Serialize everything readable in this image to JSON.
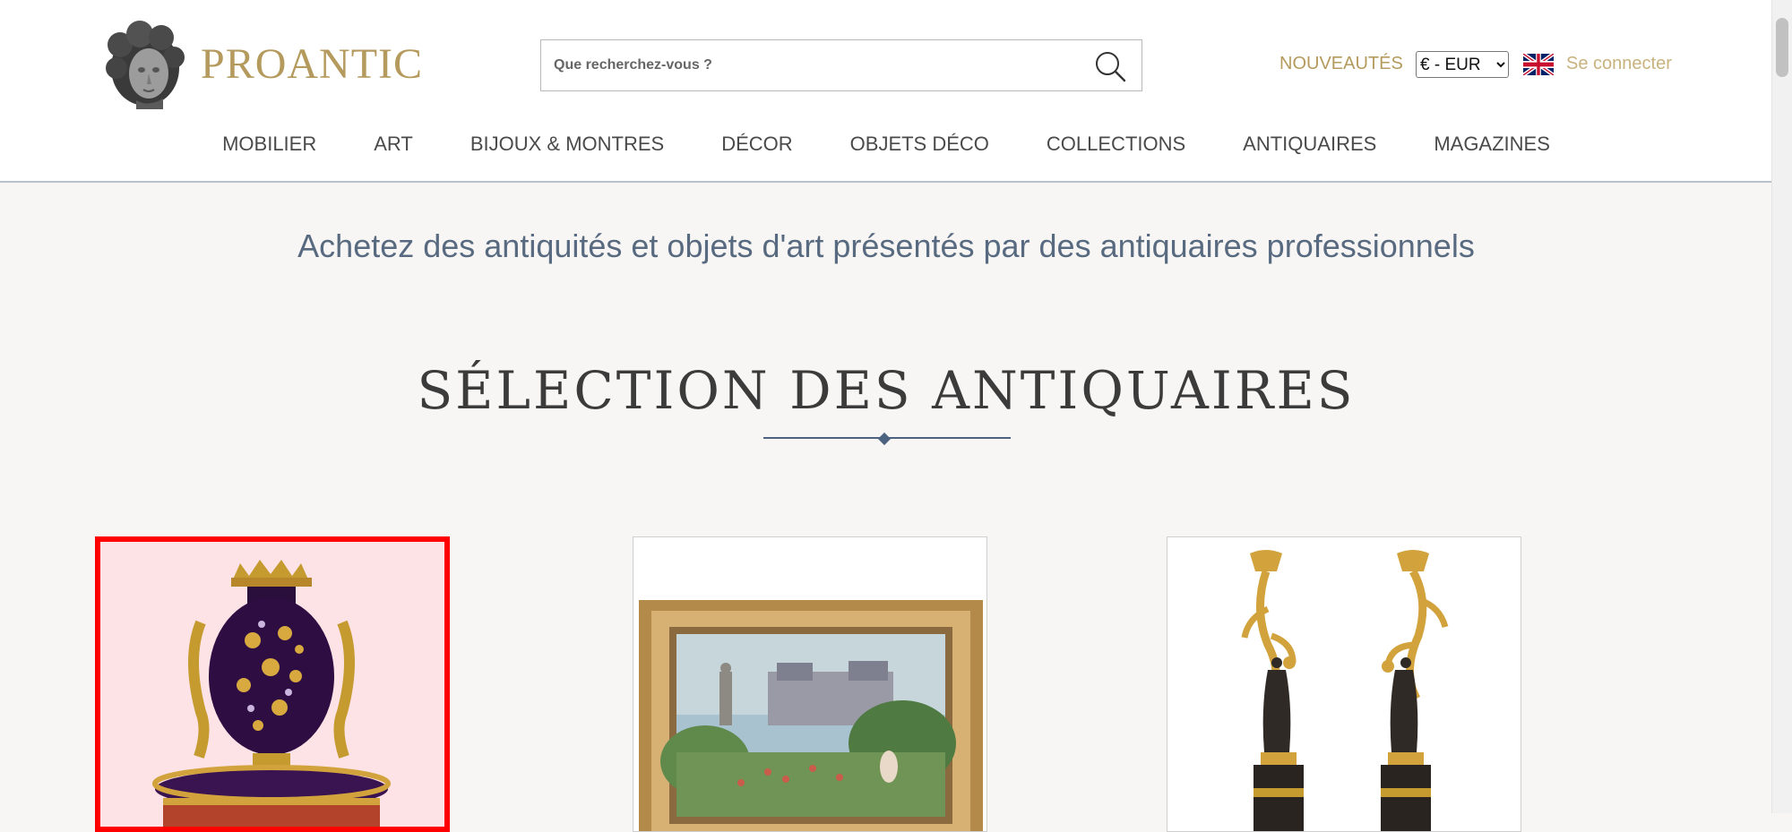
{
  "header": {
    "brand": "PROANTIC",
    "search": {
      "placeholder": "Que recherchez-vous ?"
    },
    "nouveautes": "NOUVEAUTÉS",
    "currency": {
      "selected": "€ - EUR"
    },
    "language_flag": "uk-flag-icon",
    "login": "Se connecter"
  },
  "nav": {
    "items": [
      {
        "label": "MOBILIER"
      },
      {
        "label": "ART"
      },
      {
        "label": "BIJOUX & MONTRES"
      },
      {
        "label": "DÉCOR"
      },
      {
        "label": "OBJETS DÉCO"
      },
      {
        "label": "COLLECTIONS"
      },
      {
        "label": "ANTIQUAIRES"
      },
      {
        "label": "MAGAZINES"
      }
    ]
  },
  "main": {
    "tagline": "Achetez des antiquités et objets d'art présentés par des antiquaires professionnels",
    "section_title": "SÉLECTION DES ANTIQUAIRES"
  },
  "colors": {
    "brand_gold": "#b59a5d",
    "nav_text": "#4a4a4a",
    "tagline_blue": "#586a80",
    "selection_highlight": "#ff0000",
    "page_background": "#f7f6f4"
  },
  "cards": [
    {
      "image": "ormolu-mounted-vase-image",
      "selected": true
    },
    {
      "image": "framed-landscape-painting-image",
      "selected": false
    },
    {
      "image": "bronze-candelabra-pair-image",
      "selected": false
    }
  ]
}
